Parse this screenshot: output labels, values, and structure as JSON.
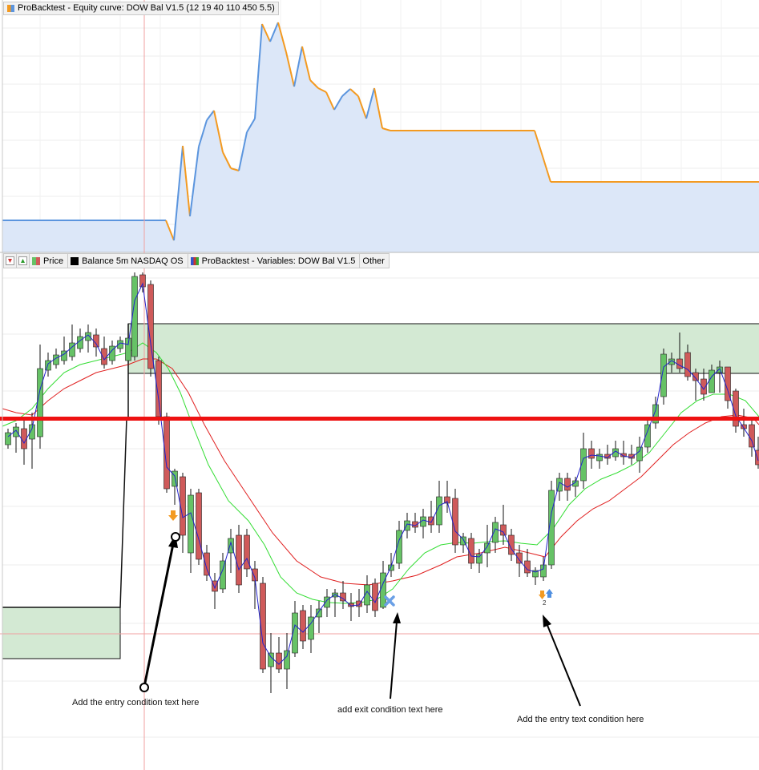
{
  "equity_panel": {
    "title": "ProBacktest - Equity curve: DOW Bal V1.5 (12 19 40 110 450 5.5)"
  },
  "legend": {
    "down_icon": "red-down-arrow-icon",
    "up_icon": "green-up-arrow-icon",
    "items": [
      {
        "label": "Price",
        "icon": "price-icon",
        "color": "#cc3333"
      },
      {
        "label": "Balance 5m NASDAQ OS",
        "icon": "black-square-icon",
        "color": "#000000"
      },
      {
        "label": "ProBacktest - Variables: DOW Bal V1.5",
        "icon": "variables-icon",
        "color": "#3355cc"
      },
      {
        "label": "Other",
        "icon": "",
        "color": ""
      }
    ]
  },
  "markers": {
    "exit_count": "2"
  },
  "annotations": {
    "entry1": "Add the entry condition text here",
    "exit": "add exit condition text here",
    "entry2": "Add the entry text condition here"
  },
  "colors": {
    "up_candle": "#66c266",
    "down_candle": "#cf5a5a",
    "fast_ma": "#2222cc",
    "mid_ma": "#33dd33",
    "slow_ma": "#e02020",
    "level_line": "#ee1111",
    "zone_fill": "#d3e9d3",
    "equity_up": "#5b95de",
    "equity_down": "#f39a21",
    "equity_fill": "#dce7f8"
  }
}
